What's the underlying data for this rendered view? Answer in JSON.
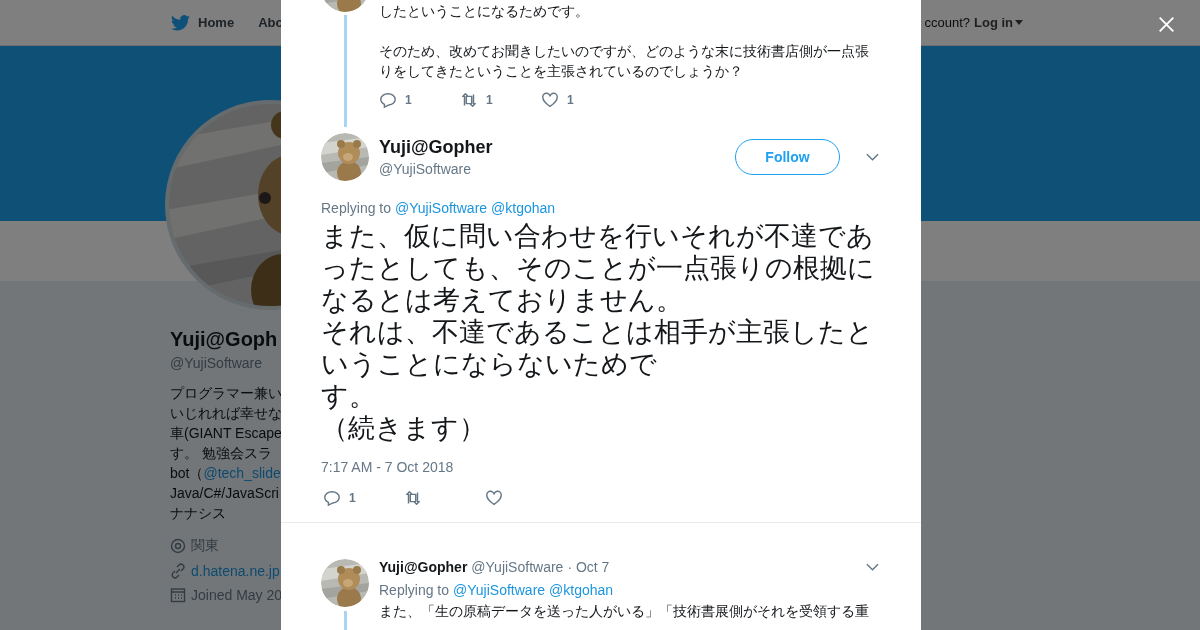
{
  "nav": {
    "items": [
      {
        "label": "Home",
        "kind": "home"
      },
      {
        "label": "Abo",
        "kind": "plain"
      }
    ],
    "account_prompt": "ccount?",
    "login": "Log in"
  },
  "profile": {
    "name": "Yuji@Goph",
    "handle": "@YujiSoftware",
    "bio": [
      {
        "text": "プログラマー兼い"
      },
      {
        "text": "いじれれば幸せな"
      },
      {
        "text": "車(GIANT Escape"
      },
      {
        "text": "す。 勉強会スラ"
      },
      {
        "text": "bot（",
        "link": "@tech_slide"
      },
      {
        "text": "Java/C#/JavaScri"
      },
      {
        "text": "ナナシス"
      }
    ],
    "location": "関東",
    "url": "d.hatena.ne.jp",
    "joined": "Joined May 20"
  },
  "thread_above": {
    "paragraphs": [
      "したということになるためです。",
      "そのため、改めてお聞きしたいのですが、どのような末に技術書店側が一点張りをしてきたということを主張されているのでしょうか？"
    ],
    "actions": [
      {
        "kind": "reply",
        "count": "1"
      },
      {
        "kind": "retweet",
        "count": "1"
      },
      {
        "kind": "like",
        "count": "1"
      }
    ]
  },
  "tweet": {
    "name": "Yuji@Gopher",
    "handle": "@YujiSoftware",
    "follow": "Follow",
    "replying_label": "Replying to",
    "mentions": [
      "@YujiSoftware",
      "@ktgohan"
    ],
    "paragraphs": [
      "また、仮に問い合わせを行いそれが不達であったとしても、そのことが一点張りの根拠になるとは考えておりません。",
      "それは、不達であることは相手が主張したということにならないためで",
      "す。",
      "（続きます）"
    ],
    "time": "7:17 AM - 7 Oct 2018",
    "actions": [
      {
        "kind": "reply",
        "count": "1"
      },
      {
        "kind": "retweet"
      },
      {
        "kind": "like"
      }
    ]
  },
  "reply": {
    "name": "Yuji@Gopher",
    "handle": "@YujiSoftware",
    "date": "· Oct 7",
    "replying_label": "Replying to",
    "mentions": [
      "@YujiSoftware",
      "@ktgohan"
    ],
    "text": "また、「生の原稿データを送った人がいる」「技術書展側がそれを受領する重"
  }
}
